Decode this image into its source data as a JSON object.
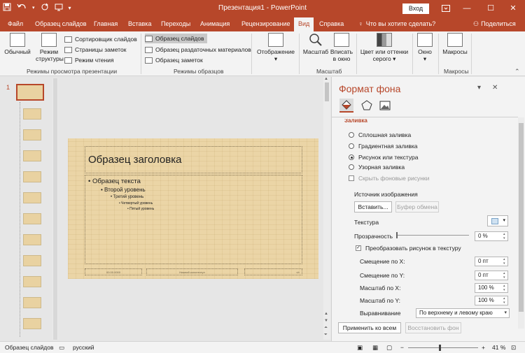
{
  "titlebar": {
    "title": "Презентация1 - PowerPoint",
    "signin": "Вход",
    "icons": [
      "save-icon",
      "undo-icon",
      "redo-icon",
      "present-icon",
      "customize-icon"
    ],
    "controls": [
      "ribbon-display-icon",
      "minimize-icon",
      "maximize-icon",
      "close-icon"
    ]
  },
  "tabs": {
    "items": [
      "Файл",
      "Образец слайдов",
      "Главная",
      "Вставка",
      "Переходы",
      "Анимация",
      "Рецензирование",
      "Вид",
      "Справка"
    ],
    "active": "Вид",
    "tell_me": "Что вы хотите сделать?",
    "share": "Поделиться"
  },
  "ribbon": {
    "views": {
      "normal": "Обычный",
      "outline": "Режим структуры",
      "sorter": "Сортировщик слайдов",
      "notes_page": "Страницы заметок",
      "reading": "Режим чтения",
      "group_label": "Режимы просмотра презентации"
    },
    "masters": {
      "slide_master": "Образец слайдов",
      "handout_master": "Образец раздаточных материалов",
      "notes_master": "Образец заметок",
      "group_label": "Режимы образцов"
    },
    "show": {
      "label": "Отображение"
    },
    "zoom": {
      "zoom": "Масштаб",
      "fit": "Вписать в окно",
      "group_label": "Масштаб"
    },
    "color": {
      "label": "Цвет или оттенки серого"
    },
    "window": {
      "label": "Окно"
    },
    "macros": {
      "label": "Макросы",
      "group_label": "Макросы"
    }
  },
  "thumbnails": {
    "number": "1"
  },
  "slide": {
    "title": "Образец заголовка",
    "levels": [
      "Образец текста",
      "Второй уровень",
      "Третий уровень",
      "Четвертый уровень",
      "Пятый уровень"
    ],
    "footer_date": "00.00.0000",
    "footer_text": "Нижний колонтитул",
    "footer_num": "‹#›"
  },
  "format_pane": {
    "title": "Формат фона",
    "section": "Заливка",
    "fill_options": [
      "Сплошная заливка",
      "Градиентная заливка",
      "Рисунок или текстура",
      "Узорная заливка"
    ],
    "selected_fill": "Рисунок или текстура",
    "hide_bg": "Скрыть фоновые рисунки",
    "source_label": "Источник изображения",
    "insert_btn": "Вставить...",
    "clipboard_btn": "Буфер обмена",
    "texture_label": "Текстура",
    "transparency_label": "Прозрачность",
    "transparency_value": "0 %",
    "tile_checkbox": "Преобразовать рисунок в текстуру",
    "offset_x_label": "Смещение по X:",
    "offset_x_value": "0 пт",
    "offset_y_label": "Смещение по Y:",
    "offset_y_value": "0 пт",
    "scale_x_label": "Масштаб по X:",
    "scale_x_value": "100 %",
    "scale_y_label": "Масштаб по Y:",
    "scale_y_value": "100 %",
    "align_label": "Выравнивание",
    "align_value": "По верхнему и левому краю",
    "apply_all": "Применить ко всем",
    "reset_bg": "Восстановить фон"
  },
  "status": {
    "mode": "Образец слайдов",
    "language": "русский",
    "zoom": "41 %"
  },
  "colors": {
    "accent": "#b7472a",
    "slide_bg": "#ebd5a6"
  }
}
